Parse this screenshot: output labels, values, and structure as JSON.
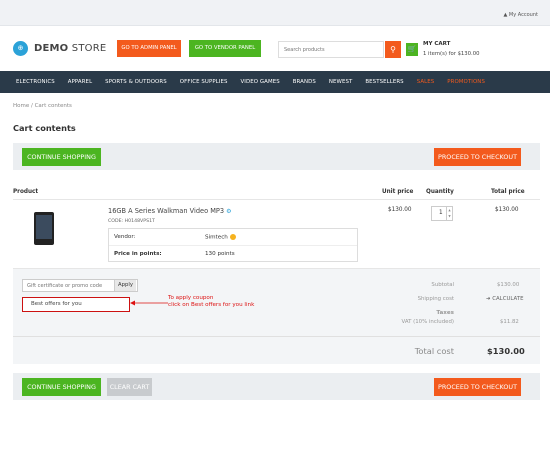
{
  "header": {
    "logo_bold": "DEMO",
    "logo_rest": " STORE",
    "admin_panel": "GO TO ADMIN PANEL",
    "vendor_panel": "GO TO VENDOR PANEL",
    "search_placeholder": "Search products",
    "cart_title": "MY CART",
    "cart_sub": "1 item(s) for $130.00"
  },
  "nav": [
    "ELECTRONICS",
    "APPAREL",
    "SPORTS & OUTDOORS",
    "OFFICE SUPPLIES",
    "VIDEO GAMES",
    "BRANDS",
    "NEWEST",
    "BESTSELLERS",
    "SALES",
    "PROMOTIONS"
  ],
  "breadcrumb": "Home  /  Cart contents",
  "page_title": "Cart contents",
  "buttons": {
    "continue": "CONTINUE SHOPPING",
    "checkout": "PROCEED TO CHECKOUT",
    "clear": "CLEAR CART"
  },
  "table": {
    "col_product": "Product",
    "col_unit": "Unit price",
    "col_qty": "Quantity",
    "col_total": "Total price"
  },
  "item": {
    "name": "16GB A Series Walkman Video MP3",
    "code": "CODE: H0148VPS1T",
    "vendor_label": "Vendor:",
    "vendor_value": "Simtech",
    "points_label": "Price in points:",
    "points_value": "130 points",
    "unit_price": "$130.00",
    "quantity": "1",
    "total_price": "$130.00"
  },
  "coupon": {
    "placeholder": "Gift certificate or promo code",
    "apply": "Apply",
    "offers_link": "Best offers for you",
    "annotation_line1": "To apply coupon",
    "annotation_line2": "click on Best offers for you link"
  },
  "summary": {
    "subtotal_label": "Subtotal",
    "subtotal_value": "$130.00",
    "shipping_label": "Shipping cost",
    "shipping_value": "CALCULATE",
    "taxes_label": "Taxes",
    "vat_label": "VAT (10% included)",
    "vat_value": "$11.82",
    "total_label": "Total cost",
    "total_value": "$130.00"
  }
}
